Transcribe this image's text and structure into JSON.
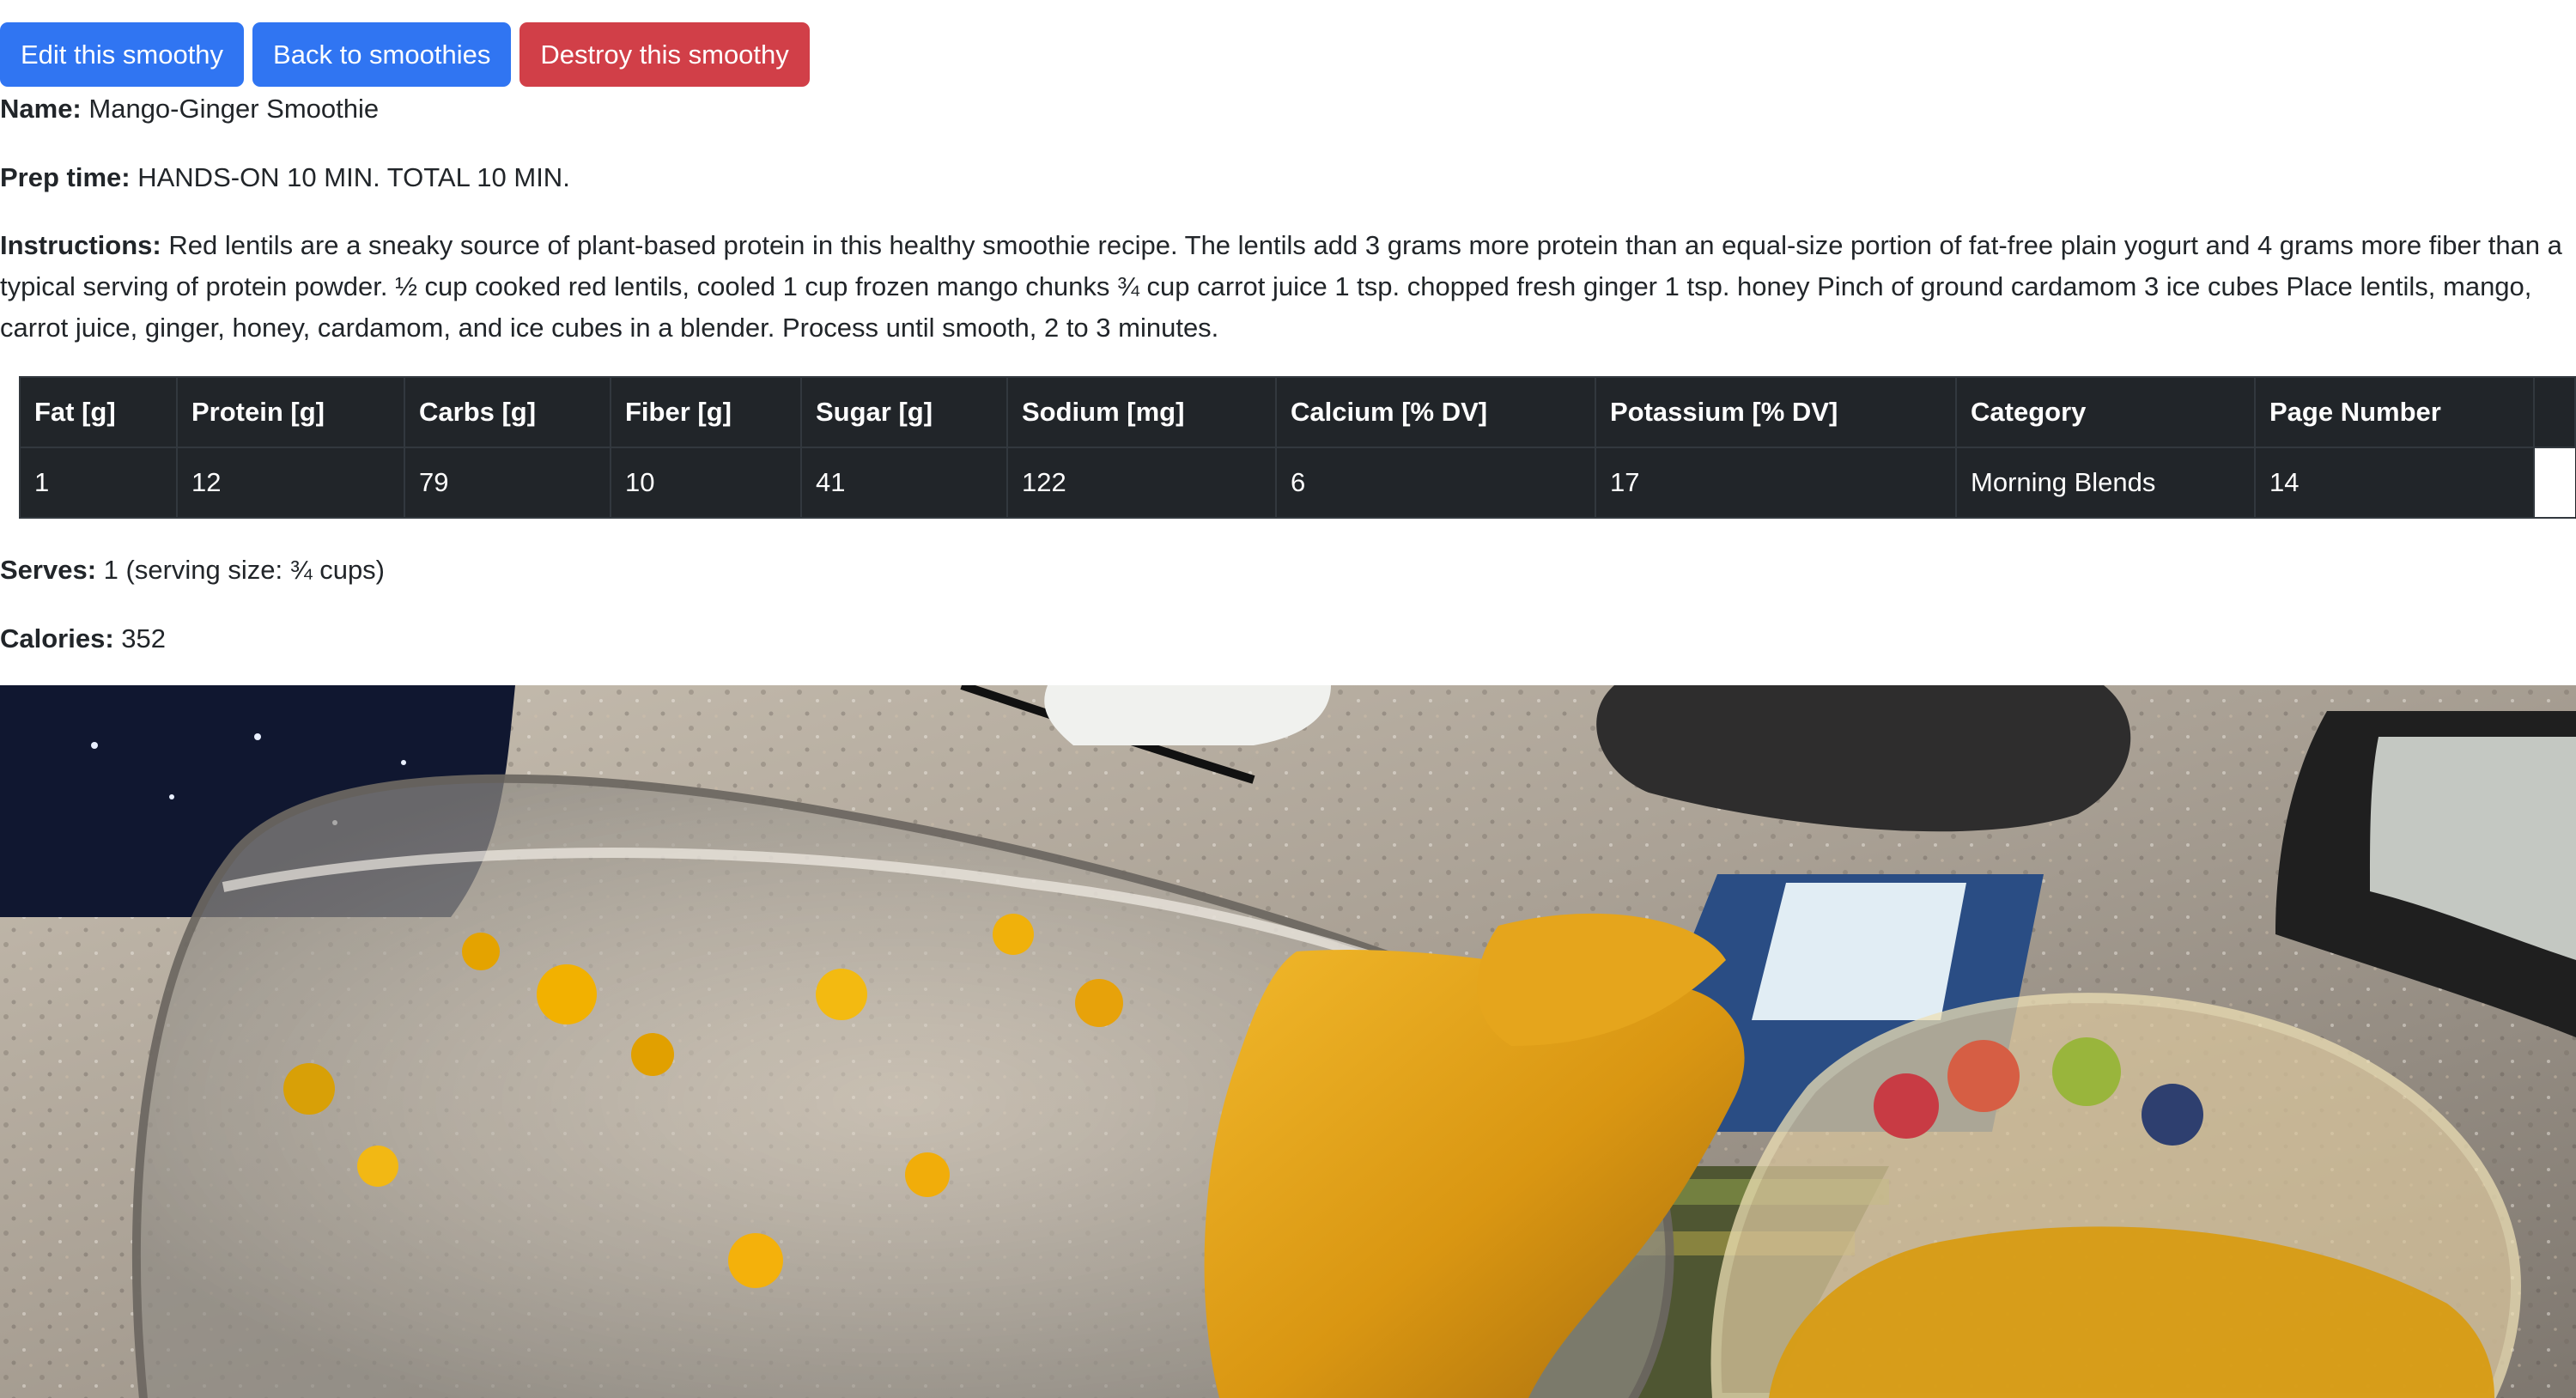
{
  "toolbar": {
    "edit_label": "Edit this smoothy",
    "back_label": "Back to smoothies",
    "destroy_label": "Destroy this smoothy"
  },
  "details": {
    "name_label": "Name:",
    "name_value": "Mango-Ginger Smoothie",
    "prep_label": "Prep time:",
    "prep_value": "HANDS-ON 10 MIN. TOTAL 10 MIN.",
    "instructions_label": "Instructions:",
    "instructions_value": "Red lentils are a sneaky source of plant-based protein in this healthy smoothie recipe. The lentils add 3 grams more protein than an equal-size portion of fat-free plain yogurt and 4 grams more fiber than a typical serving of protein powder. ½ cup cooked red lentils, cooled 1 cup frozen mango chunks ¾ cup carrot juice 1 tsp. chopped fresh ginger 1 tsp. honey Pinch of ground cardamom 3 ice cubes Place lentils, mango, carrot juice, ginger, honey, cardamom, and ice cubes in a blender. Process until smooth, 2 to 3 minutes.",
    "serves_label": "Serves:",
    "serves_value": "1 (serving size: ¾ cups)",
    "calories_label": "Calories:",
    "calories_value": "352"
  },
  "nutrition_table": {
    "headers": [
      "Fat [g]",
      "Protein [g]",
      "Carbs [g]",
      "Fiber [g]",
      "Sugar [g]",
      "Sodium [mg]",
      "Calcium [% DV]",
      "Potassium [% DV]",
      "Category",
      "Page Number"
    ],
    "row": [
      "1",
      "12",
      "79",
      "10",
      "41",
      "122",
      "6",
      "17",
      "Morning Blends",
      "14"
    ]
  },
  "photo": {
    "icon": "smoothie-photo"
  }
}
